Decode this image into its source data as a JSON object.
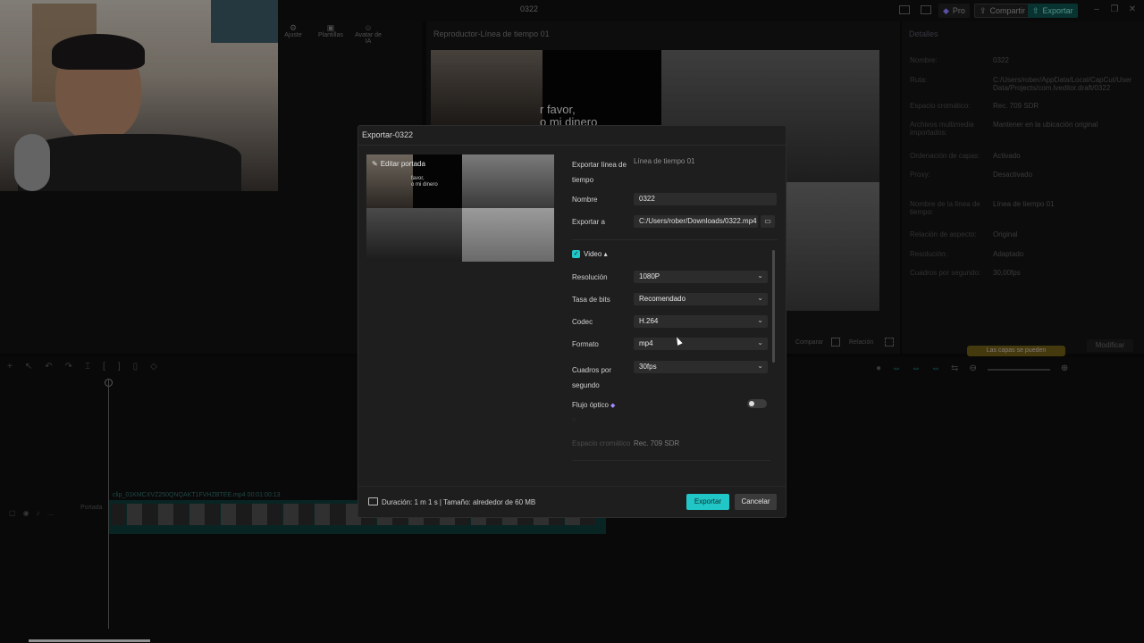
{
  "app": {
    "title": "0322",
    "pro": "Pro",
    "share": "Compartir",
    "export": "Exportar"
  },
  "left_toolbar": [
    "Ajuste",
    "Plantillas",
    "Avatar de IA"
  ],
  "player": {
    "title": "Reproductor-Línea de tiempo 01",
    "overlay_text": "r favor,\no mi dinero"
  },
  "details": {
    "title": "Detalles",
    "rows": [
      {
        "label": "Nombre:",
        "value": "0322"
      },
      {
        "label": "Ruta:",
        "value": "C:/Users/rober/AppData/Local/CapCut/User Data/Projects/com.lveditor.draft/0322"
      },
      {
        "label": "Espacio cromático:",
        "value": "Rec. 709 SDR"
      },
      {
        "label": "Archivos multimedia importados:",
        "value": "Mantener en la ubicación original"
      },
      {
        "label": "Ordenación de capas:",
        "value": "Activado"
      },
      {
        "label": "Proxy:",
        "value": "Desactivado"
      },
      {
        "label": "Nombre de la línea de tiempo:",
        "value": "Línea de tiempo 01"
      },
      {
        "label": "Relación de aspecto:",
        "value": "Original"
      },
      {
        "label": "Resolución:",
        "value": "Adaptado"
      },
      {
        "label": "Cuadros por segundo:",
        "value": "30,00fps"
      }
    ],
    "modify": "Modificar",
    "layers_note": "Las capas se pueden"
  },
  "timeline": {
    "clip_label": "clip_01KMCXVZ250QNQAKT1FVHZBTEE.mp4   00:01:00:13",
    "cover": "Portada"
  },
  "dialog": {
    "title": "Exportar-0322",
    "edit_cover": "Editar portada",
    "thumb_text": "favor,\no mi dinero",
    "export_timeline_label": "Exportar línea de tiempo",
    "export_timeline_value": "Línea de tiempo 01",
    "name_label": "Nombre",
    "name_value": "0322",
    "export_to_label": "Exportar a",
    "export_to_value": "C:/Users/rober/Downloads/0322.mp4",
    "video_label": "Video",
    "resolution_label": "Resolución",
    "resolution_value": "1080P",
    "bitrate_label": "Tasa de bits",
    "bitrate_value": "Recomendado",
    "codec_label": "Codec",
    "codec_value": "H.264",
    "format_label": "Formato",
    "format_value": "mp4",
    "fps_label": "Cuadros por segundo",
    "fps_value": "30fps",
    "optical_flow_label": "Flujo óptico",
    "color_space_label": "Espacio cromático",
    "color_space_value": "Rec. 709 SDR",
    "footer_info": "Duración: 1 m 1 s | Tamaño: alrededor de 60 MB",
    "export_button": "Exportar",
    "cancel_button": "Cancelar"
  }
}
